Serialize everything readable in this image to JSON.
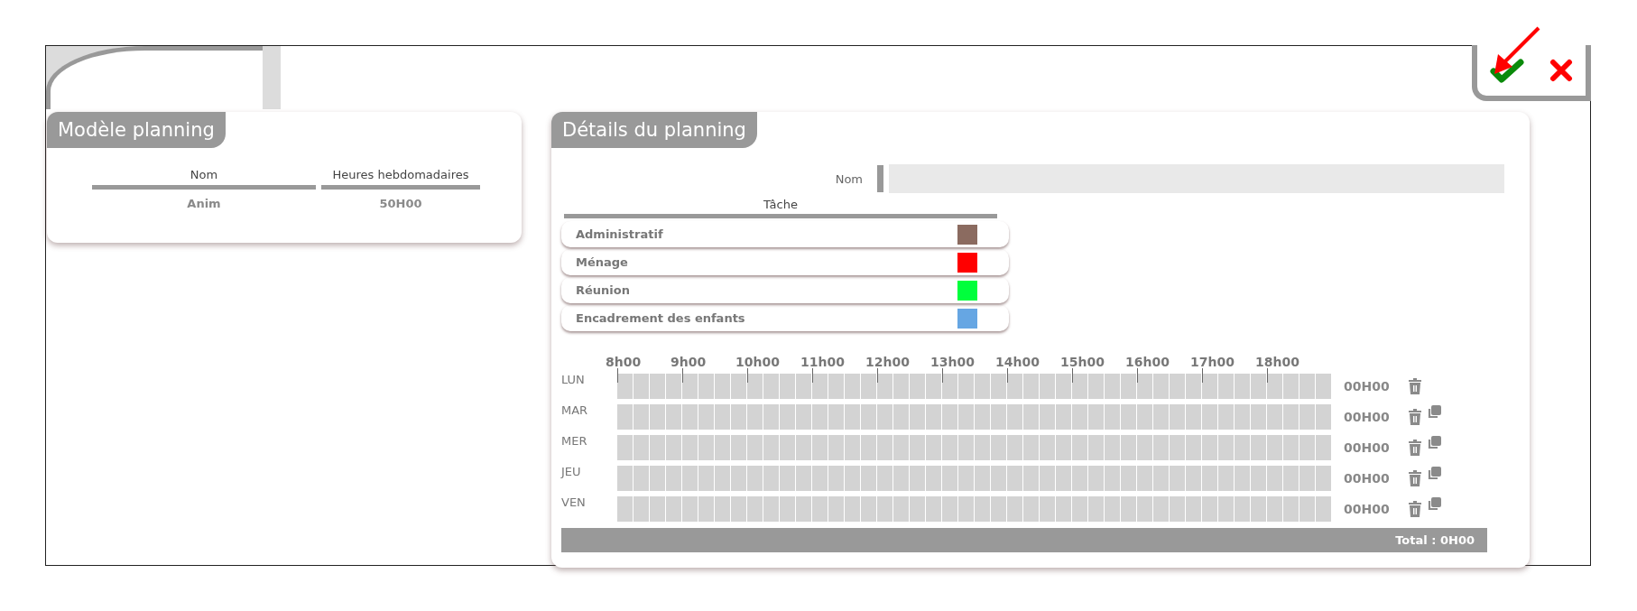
{
  "model_panel": {
    "title": "Modèle planning",
    "columns": [
      "Nom",
      "Heures hebdomadaires"
    ],
    "rows": [
      [
        "Anim",
        "50H00"
      ]
    ]
  },
  "details_panel": {
    "title": "Détails du planning",
    "name_label": "Nom",
    "task_header": "Tâche",
    "tasks": [
      {
        "label": "Administratif",
        "color": "#8b6b60"
      },
      {
        "label": "Ménage",
        "color": "#ff0000"
      },
      {
        "label": "Réunion",
        "color": "#00ff3c"
      },
      {
        "label": "Encadrement des enfants",
        "color": "#66a6e3"
      }
    ],
    "hours": [
      "8h00",
      "9h00",
      "10h00",
      "11h00",
      "12h00",
      "13h00",
      "14h00",
      "15h00",
      "16h00",
      "17h00",
      "18h00"
    ],
    "days": [
      {
        "label": "LUN",
        "total": "00H00",
        "copyable": false
      },
      {
        "label": "MAR",
        "total": "00H00",
        "copyable": true
      },
      {
        "label": "MER",
        "total": "00H00",
        "copyable": true
      },
      {
        "label": "JEU",
        "total": "00H00",
        "copyable": true
      },
      {
        "label": "VEN",
        "total": "00H00",
        "copyable": true
      }
    ],
    "total": "Total : 0H00"
  }
}
